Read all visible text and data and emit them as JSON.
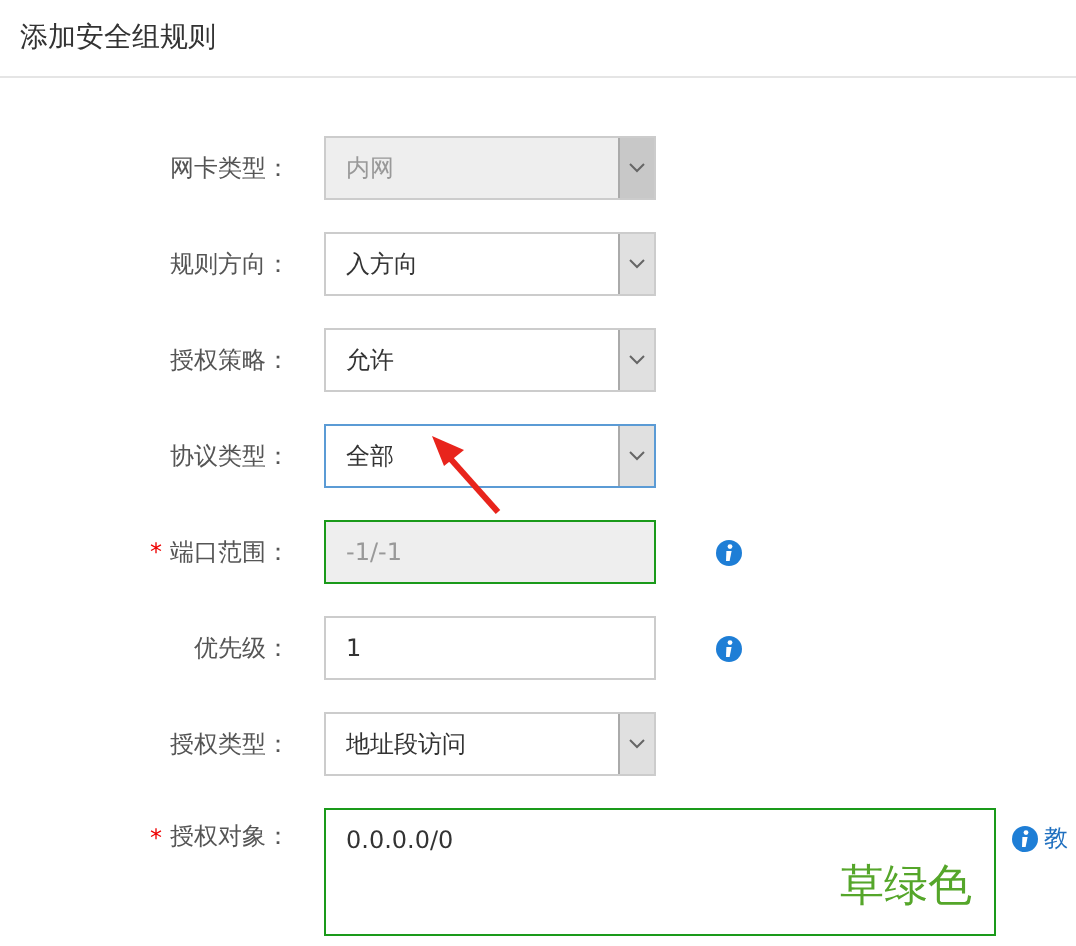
{
  "title": "添加安全组规则",
  "fields": [
    {
      "kind": "select",
      "label": "网卡类型：",
      "value": "内网",
      "disabled": true,
      "focused": false,
      "valid": false,
      "info": false,
      "pointer": false
    },
    {
      "kind": "select",
      "label": "规则方向：",
      "value": "入方向",
      "disabled": false,
      "focused": false,
      "valid": false,
      "info": false,
      "pointer": false
    },
    {
      "kind": "select",
      "label": "授权策略：",
      "value": "允许",
      "disabled": false,
      "focused": false,
      "valid": false,
      "info": false,
      "pointer": false
    },
    {
      "kind": "select",
      "label": "协议类型：",
      "value": "全部",
      "disabled": false,
      "focused": true,
      "valid": false,
      "info": false,
      "pointer": true
    },
    {
      "kind": "input",
      "required_mark": "*",
      "label": "端口范围：",
      "value": "-1/-1",
      "disabled": true,
      "focused": false,
      "valid": true,
      "info": true,
      "pointer": false
    },
    {
      "kind": "input",
      "label": "优先级：",
      "value": "1",
      "disabled": false,
      "focused": false,
      "valid": false,
      "info": true,
      "pointer": false
    },
    {
      "kind": "select",
      "label": "授权类型：",
      "value": "地址段访问",
      "disabled": false,
      "focused": false,
      "valid": false,
      "info": false,
      "pointer": false
    },
    {
      "kind": "textarea",
      "required_mark": "*",
      "label": "授权对象：",
      "value": "0.0.0.0/0",
      "disabled": false,
      "focused": false,
      "valid": true,
      "info": true,
      "pointer": false,
      "info_text": "教",
      "annotation": "草绿色"
    }
  ]
}
